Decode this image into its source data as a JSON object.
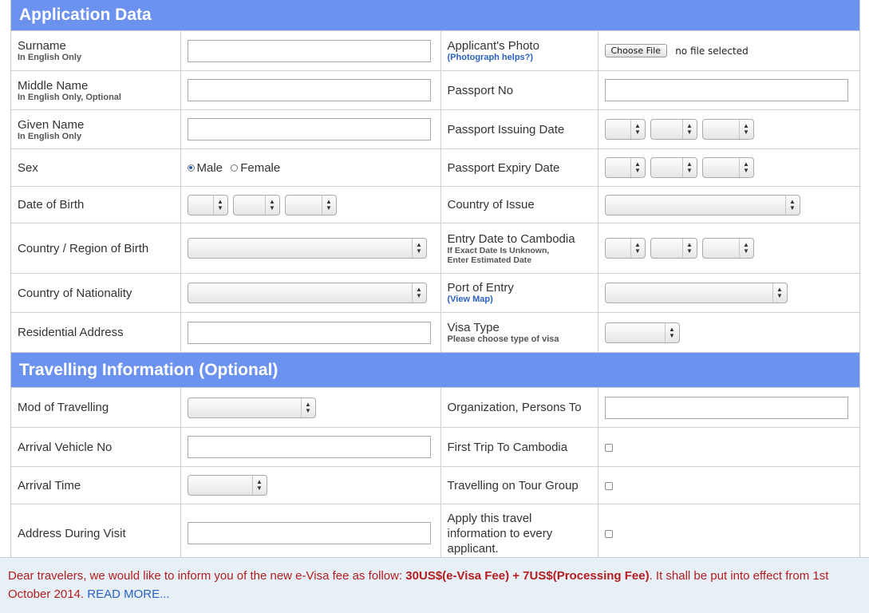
{
  "application": {
    "header": "Application Data",
    "surname": {
      "label": "Surname",
      "sub": "In English Only"
    },
    "photo": {
      "label": "Applicant's Photo",
      "link": "(Photograph helps?)",
      "button": "Choose File",
      "status": "no file selected"
    },
    "middle_name": {
      "label": "Middle Name",
      "sub": "In English Only, Optional"
    },
    "passport_no": {
      "label": "Passport No"
    },
    "given_name": {
      "label": "Given Name",
      "sub": "In English Only"
    },
    "passport_issuing": {
      "label": "Passport Issuing Date"
    },
    "sex": {
      "label": "Sex",
      "male": "Male",
      "female": "Female",
      "selected": "Male"
    },
    "passport_expiry": {
      "label": "Passport Expiry Date"
    },
    "dob": {
      "label": "Date of Birth"
    },
    "country_issue": {
      "label": "Country of Issue"
    },
    "birth_country": {
      "label": "Country / Region of Birth"
    },
    "entry_date": {
      "label": "Entry Date to Cambodia",
      "sub1": "If Exact Date Is Unknown,",
      "sub2": "Enter Estimated Date"
    },
    "nationality": {
      "label": "Country of Nationality"
    },
    "port_entry": {
      "label": "Port of Entry",
      "link": "(View Map)"
    },
    "address": {
      "label": "Residential Address"
    },
    "visa_type": {
      "label": "Visa Type",
      "sub": "Please choose type of visa"
    }
  },
  "travel": {
    "header": "Travelling Information (Optional)",
    "mode": {
      "label": "Mod of Travelling"
    },
    "organization": {
      "label": "Organization, Persons To"
    },
    "vehicle": {
      "label": "Arrival Vehicle No"
    },
    "first_trip": {
      "label": "First Trip To Cambodia"
    },
    "arrival_time": {
      "label": "Arrival Time"
    },
    "tour_group": {
      "label": "Travelling on Tour Group"
    },
    "visit_address": {
      "label": "Address During Visit"
    },
    "apply_all": {
      "label": "Apply this travel information to every applicant."
    }
  },
  "notice": {
    "text1": "Dear travelers, we would like to inform you of the new e-Visa fee as follow: ",
    "fee": "30US$(e-Visa Fee) + 7US$(Processing Fee)",
    "text2": ". It shall be put into effect from 1st October 2014. ",
    "link": "READ MORE..."
  },
  "colors": {
    "header_bg": "#6c92f0",
    "notice_bg": "#e7eff7",
    "notice_text": "#b41e1e",
    "link": "#2a62c2"
  }
}
